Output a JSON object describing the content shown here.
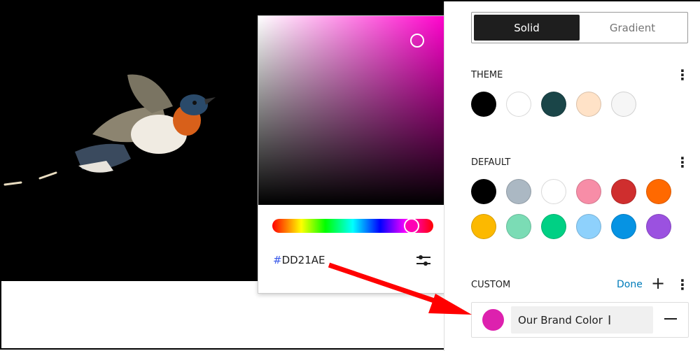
{
  "picker": {
    "hex_prefix": "#",
    "hex_value": "DD21AE",
    "hue_fraction": 0.86
  },
  "panel": {
    "tabs": [
      {
        "label": "Solid",
        "active": true
      },
      {
        "label": "Gradient",
        "active": false
      }
    ],
    "theme": {
      "label": "THEME",
      "colors": [
        "#000000",
        "#ffffff",
        "#1a4548",
        "#ffe2c7",
        "#f6f6f6"
      ]
    },
    "default": {
      "label": "DEFAULT",
      "colors": [
        "#000000",
        "#abb8c3",
        "#ffffff",
        "#f78da7",
        "#cf2e2e",
        "#ff6900",
        "#fcb900",
        "#7bdcb5",
        "#00d084",
        "#8ed1fc",
        "#0693e3",
        "#9b51e0"
      ]
    },
    "custom": {
      "label": "CUSTOM",
      "done": "Done",
      "color": "#dd21ae",
      "name": "Our Brand Color"
    }
  },
  "colors": {
    "arrow": "#ff0000",
    "accent": "#007cba"
  }
}
